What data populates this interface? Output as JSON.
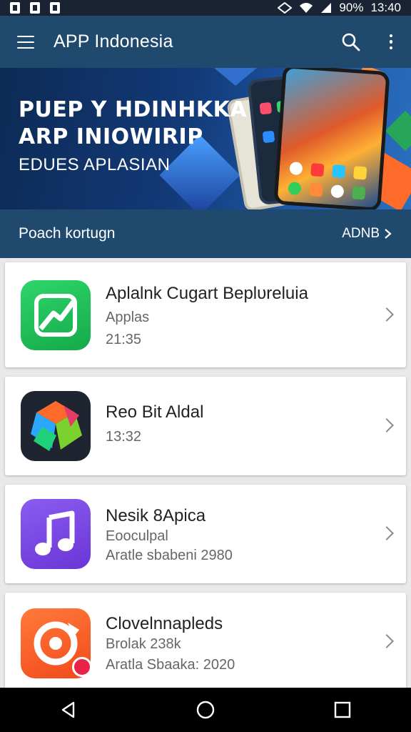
{
  "status_bar": {
    "battery": "90%",
    "time": "13:40"
  },
  "app_bar": {
    "title": "APP Indonesia",
    "search_icon": "search-icon",
    "more_icon": "more-vert-icon",
    "menu_icon": "menu-icon"
  },
  "banner": {
    "line1": "PUEP Y HDIΝHKKA",
    "line2": "ARP INIOWIRIP",
    "line3": "EDUES APLASIAN"
  },
  "section": {
    "title": "Poach kortugn",
    "more": "ADNB"
  },
  "apps": [
    {
      "name": "Aplalnk Cugart Beplυreluia",
      "line1": "Applas",
      "line2": "21:35",
      "icon": "trend-icon",
      "color": "#22c15a"
    },
    {
      "name": "Reo Bit Aldal",
      "line1": "13:32",
      "line2": "",
      "icon": "cube-icon",
      "color": "#1e2530"
    },
    {
      "name": "Nesik 8Apica",
      "line1": "Eooculpal",
      "line2": "Aratle sbabeni 2980",
      "icon": "music-note-icon",
      "color": "#7b45e0"
    },
    {
      "name": "Clovelnnapleds",
      "line1": "Brolak 238k",
      "line2": "Aratla Sbaaka: 2020",
      "icon": "gear-badge-icon",
      "color": "#ff5a24"
    }
  ],
  "nav": {
    "back": "back-icon",
    "home": "home-icon",
    "recents": "recents-icon"
  }
}
